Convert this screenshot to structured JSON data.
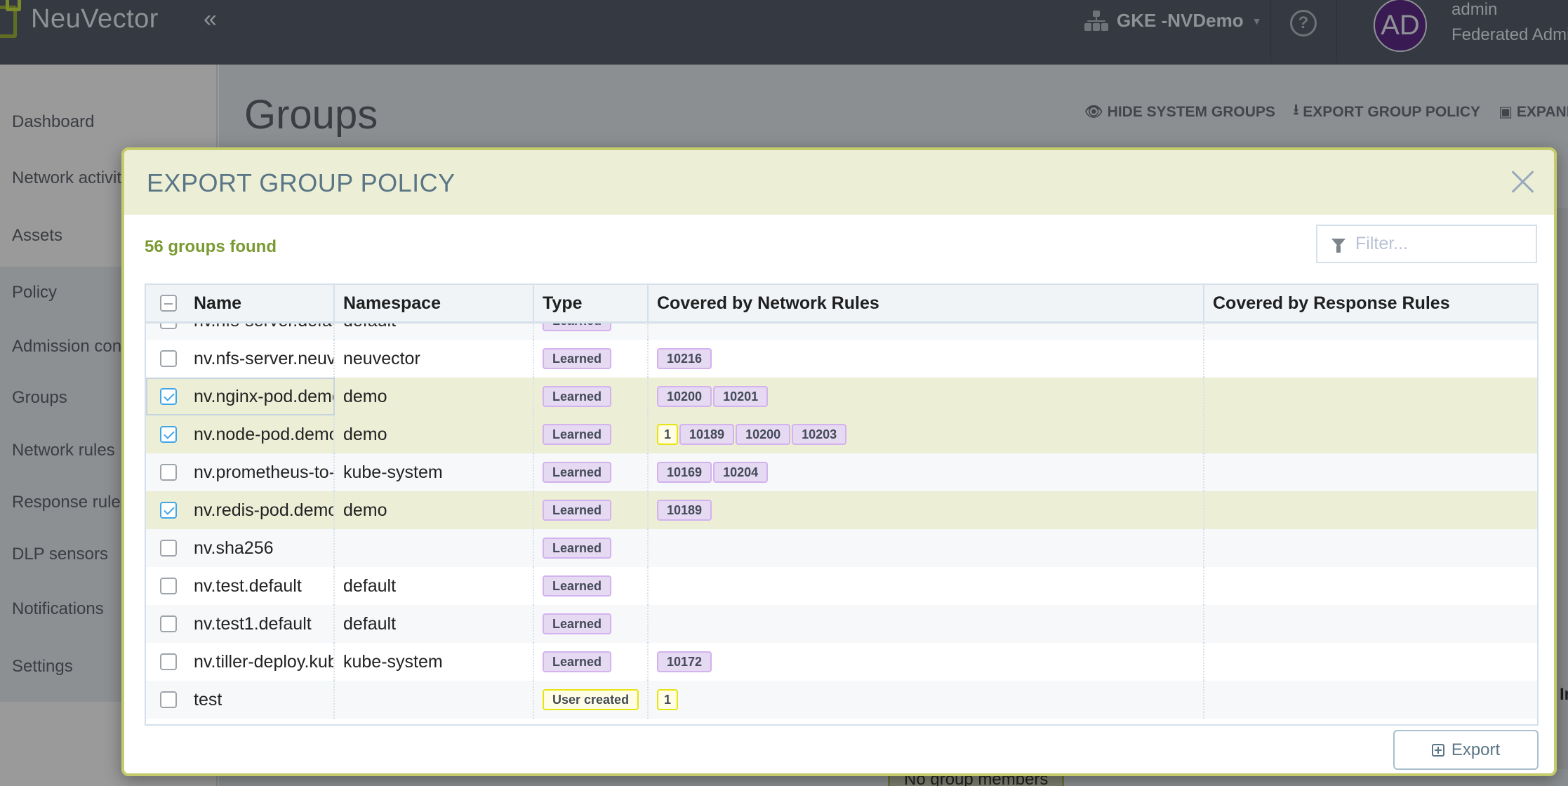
{
  "app": {
    "brand": "NeuVector",
    "collapse_icon": "double-chevron-left-icon",
    "cluster_name": "GKE -NVDemo",
    "help_icon": "question-circle-icon",
    "user": {
      "initials": "AD",
      "name": "admin",
      "role": "Federated Admin"
    }
  },
  "sidebar": {
    "items": [
      {
        "label": "Dashboard"
      },
      {
        "label": "Network activity"
      },
      {
        "label": "Assets"
      },
      {
        "label": "Policy"
      },
      {
        "label": "Admission control"
      },
      {
        "label": "Groups"
      },
      {
        "label": "Network rules"
      },
      {
        "label": "Response rules"
      },
      {
        "label": "DLP sensors"
      },
      {
        "label": "Notifications"
      },
      {
        "label": "Settings"
      }
    ]
  },
  "page": {
    "title": "Groups",
    "toolbar": {
      "hide_system_groups": "HIDE SYSTEM GROUPS",
      "export_group_policy": "EXPORT GROUP POLICY",
      "expand": "EXPAND"
    },
    "background_footer_label": "No group members",
    "background_right_text": "In"
  },
  "modal": {
    "title": "EXPORT GROUP POLICY",
    "count_text": "56 groups found",
    "filter_placeholder": "Filter...",
    "export_label": "Export",
    "columns": [
      "Name",
      "Namespace",
      "Type",
      "Covered by Network Rules",
      "Covered by Response Rules"
    ],
    "rows": [
      {
        "name": "nv.nfs-server.default",
        "namespace": "default",
        "type": "Learned",
        "type_style": "learned",
        "network_rules": [],
        "response_rules": [],
        "checked": false
      },
      {
        "name": "nv.nfs-server.neuvector",
        "namespace": "neuvector",
        "type": "Learned",
        "type_style": "learned",
        "network_rules": [
          "10216"
        ],
        "response_rules": [],
        "checked": false
      },
      {
        "name": "nv.nginx-pod.demo",
        "namespace": "demo",
        "type": "Learned",
        "type_style": "learned",
        "network_rules": [
          "10200",
          "10201"
        ],
        "response_rules": [],
        "checked": true
      },
      {
        "name": "nv.node-pod.demo",
        "namespace": "demo",
        "type": "Learned",
        "type_style": "learned",
        "network_rules": [
          "1",
          "10189",
          "10200",
          "10203"
        ],
        "response_rules": [],
        "checked": true
      },
      {
        "name": "nv.prometheus-to-sd.kube-system",
        "namespace": "kube-system",
        "type": "Learned",
        "type_style": "learned",
        "network_rules": [
          "10169",
          "10204"
        ],
        "response_rules": [],
        "checked": false
      },
      {
        "name": "nv.redis-pod.demo",
        "namespace": "demo",
        "type": "Learned",
        "type_style": "learned",
        "network_rules": [
          "10189"
        ],
        "response_rules": [],
        "checked": true
      },
      {
        "name": "nv.sha256",
        "namespace": "",
        "type": "Learned",
        "type_style": "learned",
        "network_rules": [],
        "response_rules": [],
        "checked": false
      },
      {
        "name": "nv.test.default",
        "namespace": "default",
        "type": "Learned",
        "type_style": "learned",
        "network_rules": [],
        "response_rules": [],
        "checked": false
      },
      {
        "name": "nv.test1.default",
        "namespace": "default",
        "type": "Learned",
        "type_style": "learned",
        "network_rules": [],
        "response_rules": [],
        "checked": false
      },
      {
        "name": "nv.tiller-deploy.kube-system",
        "namespace": "kube-system",
        "type": "Learned",
        "type_style": "learned",
        "network_rules": [
          "10172"
        ],
        "response_rules": [],
        "checked": false
      },
      {
        "name": "test",
        "namespace": "",
        "type": "User created",
        "type_style": "user",
        "network_rules": [
          "1"
        ],
        "response_rules": [],
        "checked": false
      }
    ],
    "user_rule_ids": [
      "1"
    ]
  },
  "colors": {
    "accent_green": "#7a9a32",
    "modal_border": "#c4cb6b",
    "modal_header_bg": "#ecefd6",
    "selected_row_bg": "#eceed6",
    "checkbox_checked": "#41a5e8",
    "learned_badge_bg": "#e6d9f2",
    "user_badge_border": "#e8e40d"
  }
}
